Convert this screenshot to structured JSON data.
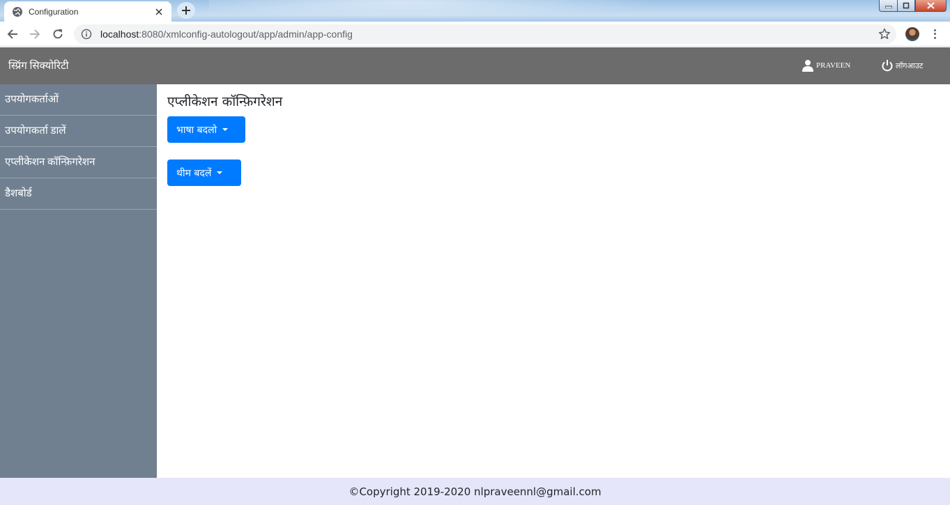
{
  "browser": {
    "tab_title": "Configuration",
    "url_host": "localhost",
    "url_rest": ":8080/xmlconfig-autologout/app/admin/app-config"
  },
  "header": {
    "brand": "स्प्रिंग सिक्योरिटी",
    "user_label": "PRAVEEN",
    "logout_label": "लॉगआउट"
  },
  "sidebar": {
    "items": [
      {
        "label": "उपयोगकर्ताओं"
      },
      {
        "label": "उपयोगकर्ता डालें"
      },
      {
        "label": "एप्लीकेशन कॉन्फ़िगरेशन"
      },
      {
        "label": "डैशबोर्ड"
      }
    ]
  },
  "main": {
    "title": "एप्लीकेशन कॉन्फ़िगरेशन",
    "language_button": "भाषा बदलो",
    "theme_button": "थीम बदलें"
  },
  "footer": {
    "text": "©Copyright 2019-2020 nlpraveennl@gmail.com"
  },
  "colors": {
    "header_bg": "#6c6c6c",
    "sidebar_bg": "#708090",
    "button_bg": "#007bff",
    "footer_bg": "#e6e6fa"
  }
}
